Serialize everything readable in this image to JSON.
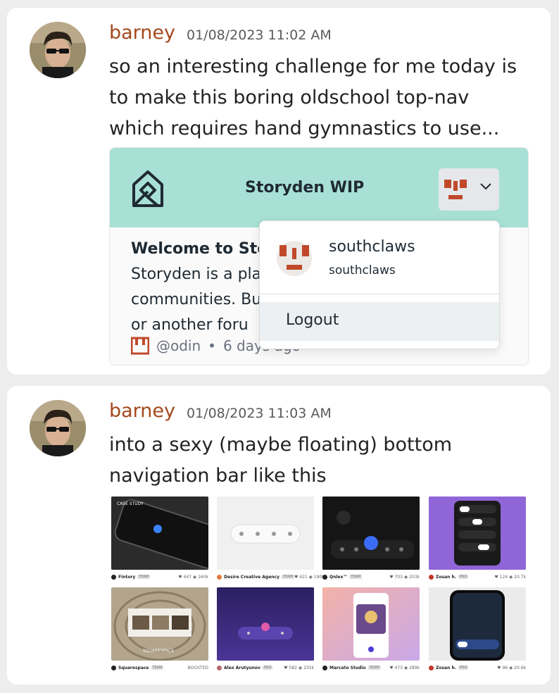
{
  "messages": [
    {
      "author": "barney",
      "timestamp": "01/08/2023 11:02 AM",
      "lines": [
        "so an interesting challenge for me today is",
        "to make this boring oldschool top-nav",
        "which requires hand gymnastics to use..."
      ],
      "embed": {
        "site_title": "Storyden WIP",
        "welcome_heading": "Welcome to Sto",
        "body_lines": [
          "Storyden is a pla",
          "communities. Bu",
          "or another foru"
        ],
        "meta_handle": "@odin",
        "meta_sep": "•",
        "meta_age": "6 days ago",
        "dropdown": {
          "name": "southclaws",
          "handle": "southclaws",
          "logout_label": "Logout"
        }
      }
    },
    {
      "author": "barney",
      "timestamp": "01/08/2023 11:03 AM",
      "lines": [
        "into a sexy (maybe floating) bottom",
        "navigation bar like this"
      ],
      "thumbnails": [
        {
          "name": "Fintory",
          "tag": "TEAM",
          "likes": "447",
          "views": "160k",
          "overlay": "CASE STUDY"
        },
        {
          "name": "Desire Creative Agency",
          "tag": "TEAM",
          "likes": "421",
          "views": "190k",
          "overlay": ""
        },
        {
          "name": "Qnlex™",
          "tag": "TEAM",
          "likes": "703",
          "views": "203k",
          "overlay": ""
        },
        {
          "name": "Zosan h.",
          "tag": "PRO",
          "likes": "124",
          "views": "20.7k",
          "overlay": ""
        },
        {
          "name": "Squarespace",
          "tag": "TEAM",
          "likes": "BOOSTED",
          "views": "",
          "overlay": "SQUARESPACE"
        },
        {
          "name": "Alex Arutyunov",
          "tag": "PRO",
          "likes": "582",
          "views": "235k",
          "overlay": ""
        },
        {
          "name": "Marcato Studio",
          "tag": "TEAM",
          "likes": "473",
          "views": "289k",
          "overlay": ""
        },
        {
          "name": "Zosan h.",
          "tag": "PRO",
          "likes": "96",
          "views": "20.6k",
          "overlay": ""
        }
      ]
    }
  ],
  "colors": {
    "author": "#a4481c",
    "nav_teal": "#a8e0d6",
    "logo_red": "#c0492a"
  }
}
